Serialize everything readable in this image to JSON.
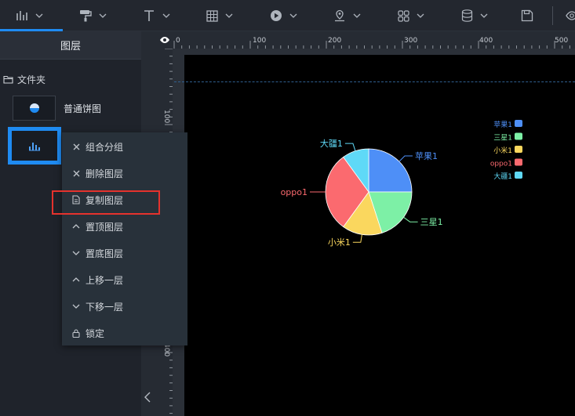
{
  "toolbar": {
    "tools": [
      {
        "name": "chart-tool",
        "icon": "bar-chart-icon"
      },
      {
        "name": "decoration-tool",
        "icon": "paint-roller-icon"
      },
      {
        "name": "text-tool",
        "icon": "text-icon"
      },
      {
        "name": "table-tool",
        "icon": "table-icon"
      },
      {
        "name": "media-tool",
        "icon": "play-icon"
      },
      {
        "name": "map-tool",
        "icon": "map-pin-icon"
      },
      {
        "name": "component-tool",
        "icon": "grid-icon"
      },
      {
        "name": "data-tool",
        "icon": "database-icon"
      },
      {
        "name": "save-tool",
        "icon": "save-icon"
      },
      {
        "name": "preview-tool",
        "icon": "eye-icon"
      }
    ]
  },
  "layers_panel": {
    "title": "图层",
    "folder_label": "文件夹",
    "layers": [
      {
        "label": "普通饼图",
        "icon": "pie-chart-icon"
      },
      {
        "label": "",
        "icon": "bar-chart-icon",
        "selected": true
      }
    ]
  },
  "context_menu": {
    "items": [
      {
        "label": "组合分组",
        "icon": "close-icon"
      },
      {
        "label": "删除图层",
        "icon": "close-icon"
      },
      {
        "label": "复制图层",
        "icon": "document-icon",
        "highlighted": true
      },
      {
        "label": "置顶图层",
        "icon": "chevron-up-icon"
      },
      {
        "label": "置底图层",
        "icon": "chevron-down-icon"
      },
      {
        "label": "上移一层",
        "icon": "chevron-up-icon"
      },
      {
        "label": "下移一层",
        "icon": "chevron-down-icon"
      },
      {
        "label": "锁定",
        "icon": "lock-icon"
      }
    ]
  },
  "ruler": {
    "horizontal_labels": [
      "0",
      "100",
      "200",
      "300",
      "400",
      "500"
    ],
    "vertical_labels": [
      "100",
      "400"
    ]
  },
  "colors": {
    "accent": "#1f8bf2",
    "highlight": "#e5322d"
  },
  "chart_data": {
    "type": "pie",
    "categories": [
      "苹果1",
      "三星1",
      "小米1",
      "oppo1",
      "大疆1"
    ],
    "values": [
      25,
      20,
      15,
      30,
      10
    ],
    "colors": [
      "#4e8ff7",
      "#7df0a6",
      "#fad75e",
      "#fb6a6f",
      "#5fd9f7"
    ],
    "legend_position": "top-right"
  }
}
